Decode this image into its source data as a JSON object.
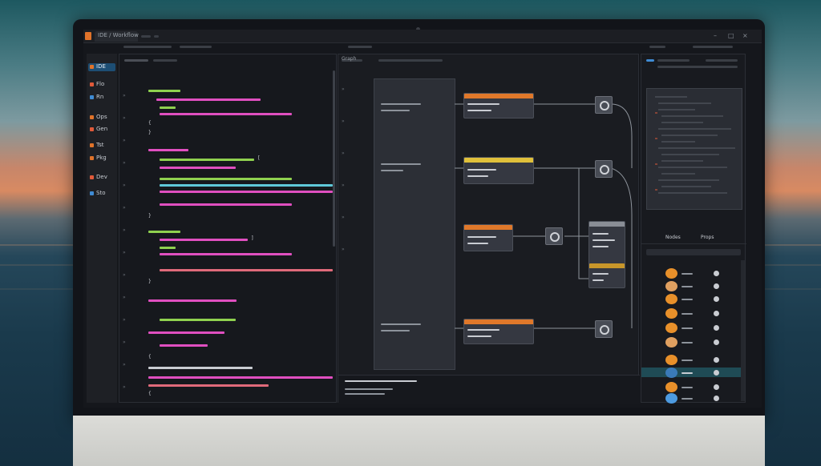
{
  "app": {
    "tab_title": "IDE / Workflow",
    "window_controls": [
      "–",
      "□",
      "×"
    ]
  },
  "sidebar": {
    "items": [
      {
        "label": "IDE",
        "color": "#e0732a",
        "active": true
      },
      {
        "label": "Flo",
        "color": "#e05a3a",
        "active": false
      },
      {
        "label": "Rn",
        "color": "#3f8bd4",
        "active": false
      },
      {
        "label": "Ops",
        "color": "#e0732a",
        "active": false
      },
      {
        "label": "Gen",
        "color": "#e05a3a",
        "active": false
      },
      {
        "label": "Tst",
        "color": "#e0732a",
        "active": false
      },
      {
        "label": "Pkg",
        "color": "#e0732a",
        "active": false
      },
      {
        "label": "Dev",
        "color": "#e05a3a",
        "active": false
      },
      {
        "label": "Sto",
        "color": "#3f8bd4",
        "active": false
      }
    ]
  },
  "code_editor": {
    "accent_colors": {
      "green": "#8fd14f",
      "magenta": "#e04fc0",
      "red": "#e06a7a",
      "cyan": "#5fc8d8"
    },
    "snippets": [
      "{",
      "}",
      "{",
      "}",
      "{",
      "}",
      "[",
      "]"
    ]
  },
  "graph": {
    "node_header_colors": [
      "#e0782a",
      "#e0c03a",
      "#e0782a",
      "#e0782a",
      "#c8962a"
    ],
    "toolbar_label": "Graph"
  },
  "right_panel": {
    "toolbar_labels": [
      "Nodes",
      "Props"
    ],
    "list_rows": 10,
    "selected_row": 7,
    "orb_colors": [
      "#e8902a",
      "#e0a060",
      "#e8902a",
      "#e8902a",
      "#e8902a",
      "#e0a060",
      "#e8902a",
      "#3a7ab8",
      "#e8902a",
      "#4d9be0"
    ]
  }
}
